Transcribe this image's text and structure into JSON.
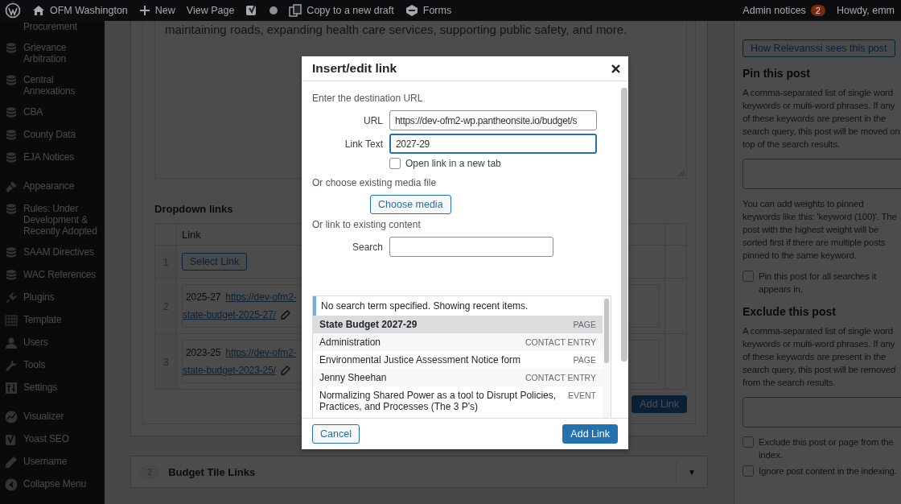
{
  "admin_bar": {
    "site": "OFM Washington",
    "new": "New",
    "view_page": "View Page",
    "copy": "Copy to a new draft",
    "forms": "Forms",
    "notices": "Admin notices",
    "notices_count": "2",
    "howdy": "Howdy, emm"
  },
  "sidebar": {
    "groups": [
      [
        {
          "label": "Procurement"
        },
        {
          "label": "Grievance Arbitration"
        },
        {
          "label": "Central Annexations"
        },
        {
          "label": "CBA"
        },
        {
          "label": "County Data"
        },
        {
          "label": "EJA Notices"
        }
      ],
      [
        {
          "label": "Appearance"
        },
        {
          "label": "Rules: Under Development & Recently Adopted"
        },
        {
          "label": "SAAM Directives"
        },
        {
          "label": "WAC References"
        },
        {
          "label": "Plugins"
        },
        {
          "label": "Template"
        },
        {
          "label": "Users"
        },
        {
          "label": "Tools"
        },
        {
          "label": "Settings"
        }
      ],
      [
        {
          "label": "Visualizer"
        },
        {
          "label": "Yoast SEO"
        },
        {
          "label": "Username"
        },
        {
          "label": "Collapse Menu"
        }
      ]
    ]
  },
  "editor": {
    "text": "maintaining roads, expanding health care services, supporting public safety, and more."
  },
  "dropdown_links": {
    "label": "Dropdown links",
    "column": "Link",
    "rows": [
      {
        "index": "1",
        "kind": "button",
        "label": "Select Link"
      },
      {
        "index": "2",
        "kind": "link",
        "year": "2025-27",
        "url": "https://dev-ofm2-",
        "path": "state-budget-2025-27/"
      },
      {
        "index": "3",
        "kind": "link",
        "year": "2023-25",
        "url": "https://dev-ofm2-",
        "path": "state-budget-2023-25/"
      }
    ],
    "add_button": "Add Link"
  },
  "budget_tile_links": {
    "count": "2",
    "title": "Budget Tile Links",
    "toggle": "▼"
  },
  "relevanssi": {
    "button": "How Relevanssi sees this post",
    "pin_heading": "Pin this post",
    "pin_text": "A comma-separated list of single word keywords or multi-word phrases. If any of these keywords are present in the search query, this post will be moved on top of the search results.",
    "weights_text": "You can add weights to pinned keywords like this: 'keyword (100)'. The post with the highest weight will be sorted first if there are multiple posts pinned to the same keyword.",
    "pin_all": {
      "label": "Pin this post for all searches it appears in.",
      "checked": false
    },
    "exclude_heading": "Exclude this post",
    "exclude_text": "A comma-separated list of single word keywords or multi-word phrases. If any of these keywords are present in the search query, this post will be removed from the search results.",
    "options": [
      {
        "label": "Exclude this post or page from the index.",
        "checked": false
      },
      {
        "label": "Ignore post content in the indexing.",
        "checked": false
      }
    ]
  },
  "dialog": {
    "title": "Insert/edit link",
    "intro": "Enter the destination URL",
    "url": {
      "label": "URL",
      "value": "https://dev-ofm2-wp.pantheonsite.io/budget/s"
    },
    "link_text": {
      "label": "Link Text",
      "value": "2027-29"
    },
    "new_tab": {
      "label": "Open link in a new tab",
      "checked": false
    },
    "media_label": "Or choose existing media file",
    "media_button": "Choose media",
    "existing_label": "Or link to existing content",
    "search": {
      "label": "Search"
    },
    "notice": "No search term specified. Showing recent items.",
    "results": [
      {
        "title": "State Budget 2027-29",
        "type": "PAGE",
        "selected": true
      },
      {
        "title": "Administration",
        "type": "CONTACT ENTRY",
        "selected": false
      },
      {
        "title": "Environmental Justice Assessment Notice form",
        "type": "PAGE",
        "selected": false
      },
      {
        "title": "Jenny Sheehan",
        "type": "CONTACT ENTRY",
        "selected": false
      },
      {
        "title": "Normalizing Shared Power as a tool to Disrupt Policies, Practices, and Processes (The 3 P's)",
        "type": "EVENT",
        "selected": false
      }
    ],
    "cancel": "Cancel",
    "submit": "Add Link"
  }
}
